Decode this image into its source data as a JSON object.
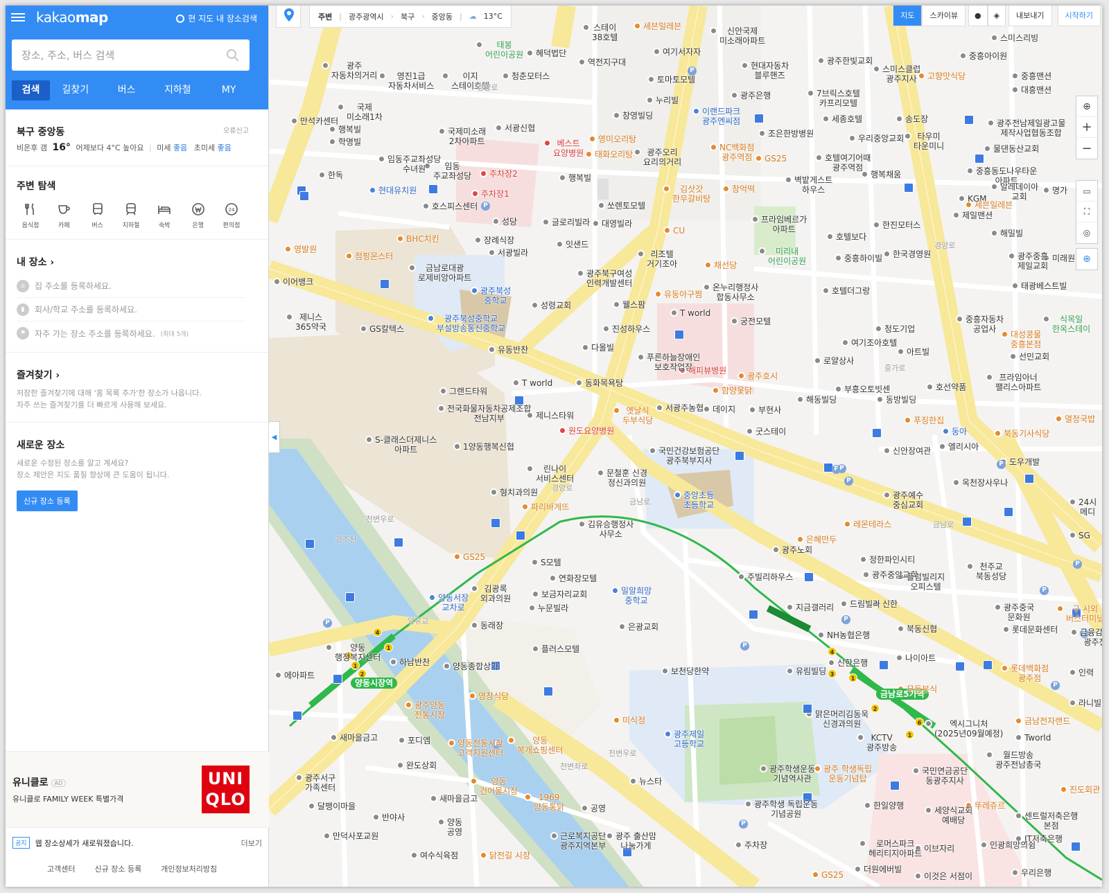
{
  "app": {
    "logo_light": "kakao",
    "logo_bold": "map",
    "here_search": "현 지도 내 장소검색"
  },
  "search": {
    "placeholder": "장소, 주소, 버스 검색"
  },
  "tabs": [
    "검색",
    "길찾기",
    "버스",
    "지하철",
    "MY"
  ],
  "weather": {
    "area": "북구 중앙동",
    "report": "오류신고",
    "desc": "비온후 갬",
    "temp": "16°",
    "compare": "어제보다 4°C 높아요",
    "dust_label": "미세",
    "dust_value": "좋음",
    "fine_label": "초미세",
    "fine_value": "좋음"
  },
  "explore": {
    "title": "주변 탐색",
    "items": [
      "음식점",
      "카페",
      "버스",
      "지하철",
      "숙박",
      "은행",
      "편의점"
    ]
  },
  "myplace": {
    "title": "내 장소",
    "home": "집 주소를 등록하세요.",
    "work": "회사/학교 주소를 등록하세요.",
    "freq": "자주 가는 장소 주소를 등록하세요.",
    "freq_note": "(최대 5개)"
  },
  "favorites": {
    "title": "즐겨찾기",
    "line1": "저장한 즐겨찾기에 대해 '홈 목록 추가'한 장소가 나옵니다.",
    "line2": "자주 쓰는 즐겨찾기를 더 빠르게 사용해 보세요."
  },
  "newplace": {
    "title": "새로운 장소",
    "line1": "새로운 수정된 장소를 알고 계세요?",
    "line2": "장소 제안은 지도 품질 향상에 큰 도움이 됩니다.",
    "button": "신규 장소 등록"
  },
  "ad": {
    "brand": "유니클로",
    "tag": "AD",
    "desc": "유니클로 FAMILY WEEK 특별가격",
    "logo_line1": "UNI",
    "logo_line2": "QLO"
  },
  "notice": {
    "tag": "공지",
    "text": "웹 장소상세가 새로워졌습니다.",
    "more": "더보기"
  },
  "footer": [
    "고객센터",
    "신규 장소 등록",
    "개인정보처리방침"
  ],
  "topbar": {
    "nearby": "주변",
    "crumbs": [
      "광주광역시",
      "북구",
      "중앙동"
    ],
    "temp": "13°C"
  },
  "map_modes": {
    "map": "지도",
    "sky": "스카이뷰",
    "share": "내보내기",
    "start": "시작하기"
  },
  "labels": [
    [
      "광주\n자동차의거리",
      90,
      80,
      ""
    ],
    [
      "영진1급\n자동차서비스",
      172,
      95,
      ""
    ],
    [
      "이지\n스테이호텔",
      263,
      95,
      ""
    ],
    [
      "청춘모터스",
      350,
      95,
      ""
    ],
    [
      "태봉\n어린이공원",
      312,
      50,
      "g"
    ],
    [
      "혜덕법단",
      385,
      62,
      ""
    ],
    [
      "역전지구대",
      460,
      75,
      ""
    ],
    [
      "여기서자자",
      568,
      60,
      ""
    ],
    [
      "현대자동차\n블루핸즈",
      695,
      80,
      ""
    ],
    [
      "광주한빛교회",
      805,
      73,
      ""
    ],
    [
      "스미스클럽\n광주지사",
      885,
      85,
      ""
    ],
    [
      "고향맛식당",
      950,
      95,
      "o"
    ],
    [
      "중흥아이원",
      1010,
      66,
      ""
    ],
    [
      "중흥맨션",
      1085,
      95,
      ""
    ],
    [
      "대흥맨션",
      1085,
      115,
      ""
    ],
    [
      "세븐일레븐",
      540,
      23,
      "o"
    ],
    [
      "신안국제\n미소래아파트",
      650,
      30,
      ""
    ],
    [
      "스테이\n38호텔",
      466,
      25,
      ""
    ],
    [
      "국제\n미소래1차",
      112,
      140,
      ""
    ],
    [
      "만석카센터",
      45,
      160,
      ""
    ],
    [
      "행복빌",
      100,
      172,
      ""
    ],
    [
      "학명빌",
      100,
      190,
      ""
    ],
    [
      "국제미소래\n2차아파트",
      258,
      175,
      ""
    ],
    [
      "서광신협",
      340,
      170,
      ""
    ],
    [
      "토마토모텔",
      560,
      100,
      ""
    ],
    [
      "누리빌",
      558,
      130,
      ""
    ],
    [
      "광주은행",
      680,
      123,
      ""
    ],
    [
      "이랜드파크\n광주엔씨점",
      625,
      146,
      "b"
    ],
    [
      "7브릭스호텔\n카프리모텔",
      790,
      120,
      ""
    ],
    [
      "스미스리빙",
      1055,
      40,
      ""
    ],
    [
      "창영빌딩",
      510,
      152,
      ""
    ],
    [
      "베스트\n요양병원",
      410,
      192,
      "r"
    ],
    [
      "영미오리탕",
      475,
      186,
      "o"
    ],
    [
      "태화오리탕",
      470,
      208,
      "o"
    ],
    [
      "광주오리\n요리의거리",
      540,
      205,
      ""
    ],
    [
      "NC백화점\n광주역점",
      650,
      198,
      "o"
    ],
    [
      "세종호텔",
      812,
      157,
      ""
    ],
    [
      "송도장",
      918,
      157,
      ""
    ],
    [
      "광주전남제일광고물\n제작사업협동조합",
      1050,
      163,
      ""
    ],
    [
      "조은한방병원",
      720,
      178,
      ""
    ],
    [
      "우리중앙교회",
      850,
      185,
      ""
    ],
    [
      "호텔여기어때\n광주역점",
      802,
      213,
      ""
    ],
    [
      "타우미\n타운미니",
      930,
      182,
      ""
    ],
    [
      "물댄동산교회",
      1045,
      200,
      ""
    ],
    [
      "GS25",
      715,
      214,
      "o"
    ],
    [
      "임동주교좌성당\n수녀원",
      171,
      215,
      ""
    ],
    [
      "임동\n주교좌성당",
      237,
      225,
      ""
    ],
    [
      "주차장2",
      318,
      236,
      "r"
    ],
    [
      "행복빌",
      432,
      242,
      ""
    ],
    [
      "김삿갓\n한우갈비탕",
      582,
      258,
      "o"
    ],
    [
      "벽밭게스트\n하우스",
      758,
      245,
      ""
    ],
    [
      "행복채움",
      868,
      237,
      ""
    ],
    [
      "중흥동도나우타운\n아파트",
      1020,
      232,
      ""
    ],
    [
      "알레데이아\n교회",
      1055,
      255,
      ""
    ],
    [
      "명가",
      1130,
      260,
      ""
    ],
    [
      "한독",
      85,
      238,
      ""
    ],
    [
      "현대유치원",
      158,
      260,
      "b"
    ],
    [
      "주차장1",
      306,
      265,
      "r"
    ],
    [
      "창억떡",
      668,
      258,
      "o"
    ],
    [
      "KGM",
      1008,
      272,
      ""
    ],
    [
      "세븐일레븐",
      1018,
      281,
      "o"
    ],
    [
      "호스피스센터",
      235,
      283,
      ""
    ],
    [
      "쏘렌토모텔",
      488,
      282,
      ""
    ],
    [
      "프라임베르가\n아파트",
      710,
      302,
      ""
    ],
    [
      "제일맨션",
      1000,
      296,
      ""
    ],
    [
      "글로리빌라",
      408,
      306,
      ""
    ],
    [
      "대영빌라",
      480,
      308,
      ""
    ],
    [
      "성당",
      336,
      305,
      ""
    ],
    [
      "CU",
      583,
      318,
      "o"
    ],
    [
      "한진모터스",
      885,
      310,
      ""
    ],
    [
      "해밀빌",
      1055,
      322,
      ""
    ],
    [
      "BHC치킨",
      198,
      330,
      "o"
    ],
    [
      "장례식장",
      310,
      332,
      ""
    ],
    [
      "영발원",
      36,
      345,
      "o"
    ],
    [
      "잇샌드",
      428,
      338,
      ""
    ],
    [
      "리조텔\n거기조아",
      545,
      352,
      ""
    ],
    [
      "미리내\n어린이공원",
      720,
      348,
      "g"
    ],
    [
      "호텔보다",
      818,
      327,
      ""
    ],
    [
      "점핑몬스터",
      124,
      355,
      "o"
    ],
    [
      "금남로대광\n로제비앙아파트",
      215,
      372,
      ""
    ],
    [
      "서광빌라",
      330,
      350,
      ""
    ],
    [
      "광주북구여성\n인력개발센터",
      458,
      380,
      ""
    ],
    [
      "중흥하이빌",
      830,
      358,
      ""
    ],
    [
      "한국경영원",
      900,
      352,
      ""
    ],
    [
      "광주중흥\n제일교회",
      1080,
      355,
      ""
    ],
    [
      "미래원",
      1130,
      358,
      ""
    ],
    [
      "채선당",
      642,
      368,
      "o"
    ],
    [
      "광주북성\n중학교",
      305,
      405,
      "b"
    ],
    [
      "온누리행정사\n합동사무소",
      640,
      400,
      ""
    ],
    [
      "유동아구찜",
      570,
      410,
      "o"
    ],
    [
      "호텔더그랑",
      812,
      405,
      ""
    ],
    [
      "태광베스트빌",
      1085,
      398,
      ""
    ],
    [
      "이어뱅크",
      20,
      392,
      ""
    ],
    [
      "성령교회",
      392,
      426,
      ""
    ],
    [
      "웰스팜",
      510,
      425,
      ""
    ],
    [
      "T world",
      593,
      437,
      ""
    ],
    [
      "궁전모텔",
      680,
      449,
      ""
    ],
    [
      "제니스\n365약국",
      38,
      443,
      ""
    ],
    [
      "광주북성중학교\n부설방송통신중학교",
      242,
      445,
      "b"
    ],
    [
      "중흥자동차\n공업사",
      1005,
      446,
      ""
    ],
    [
      "식목일\n한옥스테이",
      1130,
      446,
      "g"
    ],
    [
      "GS칼텍스",
      145,
      460,
      ""
    ],
    [
      "진성하우스",
      495,
      460,
      ""
    ],
    [
      "청도기업",
      888,
      460,
      ""
    ],
    [
      "대성콩물\n중흥본점",
      1070,
      468,
      "o"
    ],
    [
      "여기조아호텔",
      840,
      480,
      ""
    ],
    [
      "다올빌",
      465,
      487,
      ""
    ],
    [
      "아트빌",
      920,
      493,
      ""
    ],
    [
      "유동반찬",
      330,
      490,
      ""
    ],
    [
      "푸른하늘장애인\n보호작업장",
      545,
      501,
      ""
    ],
    [
      "선민교회",
      1082,
      500,
      ""
    ],
    [
      "로얄상사",
      800,
      506,
      ""
    ],
    [
      "해피뷰병원",
      605,
      520,
      "r"
    ],
    [
      "광주호시",
      690,
      528,
      "o"
    ],
    [
      "프라임아너\n팰리스아파트",
      1048,
      530,
      ""
    ],
    [
      "T world",
      365,
      538,
      ""
    ],
    [
      "동화목욕탕",
      456,
      538,
      ""
    ],
    [
      "호선약품",
      962,
      544,
      ""
    ],
    [
      "그랜드타워",
      260,
      550,
      ""
    ],
    [
      "함양옻닭",
      653,
      549,
      "o"
    ],
    [
      "부흥오토빗센",
      830,
      547,
      ""
    ],
    [
      "해동빌딩",
      775,
      562,
      ""
    ],
    [
      "동방빌딩",
      890,
      562,
      ""
    ],
    [
      "전국화물자동차공제조합\n전남지부",
      257,
      575,
      ""
    ],
    [
      "옛날식\n두부식당",
      510,
      578,
      "o"
    ],
    [
      "서광주농협",
      572,
      574,
      ""
    ],
    [
      "데이지",
      640,
      576,
      ""
    ],
    [
      "부현사",
      706,
      577,
      ""
    ],
    [
      "제니스타워",
      385,
      585,
      ""
    ],
    [
      "원도요양병원",
      432,
      607,
      "r"
    ],
    [
      "굿스테이",
      702,
      608,
      ""
    ],
    [
      "푸징한집",
      930,
      592,
      "o"
    ],
    [
      "동아",
      985,
      608,
      "b"
    ],
    [
      "열정국밥",
      1148,
      590,
      "o"
    ],
    [
      "북동기사식당",
      1060,
      611,
      "o"
    ],
    [
      "S-클래스더제니스\n아파트",
      153,
      620,
      ""
    ],
    [
      "1양동행복신협",
      280,
      630,
      ""
    ],
    [
      "국민건강보험공단\n광주북부지사",
      562,
      636,
      ""
    ],
    [
      "신안장여관",
      900,
      636,
      ""
    ],
    [
      "엘리시아",
      980,
      630,
      ""
    ],
    [
      "린나이\n서비스센터",
      385,
      662,
      ""
    ],
    [
      "문철훈 신경\n정신과의원",
      487,
      668,
      ""
    ],
    [
      "도우개발",
      1068,
      652,
      ""
    ],
    [
      "옥천장사우나",
      1000,
      682,
      ""
    ],
    [
      "형치과의원",
      333,
      696,
      ""
    ],
    [
      "중앙초등\n초등학교",
      598,
      700,
      "b"
    ],
    [
      "광주예수\n중심교회",
      900,
      700,
      ""
    ],
    [
      "24시\n메디",
      1168,
      710,
      ""
    ],
    [
      "파리바게뜨",
      378,
      717,
      "o"
    ],
    [
      "김유승행정사\n사무소",
      460,
      742,
      ""
    ],
    [
      "레몬테라스",
      843,
      742,
      "o"
    ],
    [
      "SG",
      1168,
      758,
      ""
    ],
    [
      "은혜만두",
      775,
      764,
      "o"
    ],
    [
      "S모텔",
      392,
      797,
      ""
    ],
    [
      "광주노회",
      740,
      779,
      ""
    ],
    [
      "정한파인시티",
      866,
      793,
      ""
    ],
    [
      "천주교\n북동성당",
      1020,
      803,
      ""
    ],
    [
      "GS25",
      280,
      789,
      "o"
    ],
    [
      "주빌리하우스",
      690,
      818,
      ""
    ],
    [
      "광주중앙교회",
      870,
      815,
      ""
    ],
    [
      "플럼빌리지\n오피스텔",
      920,
      818,
      ""
    ],
    [
      "연화장모텔",
      418,
      820,
      ""
    ],
    [
      "밀알희망\n중학교",
      508,
      838,
      "b"
    ],
    [
      "김광록\n외과의원",
      305,
      835,
      ""
    ],
    [
      "보금자리교회",
      393,
      843,
      ""
    ],
    [
      "양동서장\n교차로",
      244,
      848,
      "b"
    ],
    [
      "누문빌라",
      388,
      863,
      ""
    ],
    [
      "지금갤러리",
      760,
      862,
      ""
    ],
    [
      "드림빌라",
      838,
      857,
      ""
    ],
    [
      "신한",
      885,
      857,
      ""
    ],
    [
      "광주중국\n문화원",
      1060,
      862,
      ""
    ],
    [
      "구 시외\n버스터미널",
      1150,
      864,
      "o"
    ],
    [
      "동래장",
      305,
      888,
      ""
    ],
    [
      "은광교회",
      518,
      890,
      ""
    ],
    [
      "북동신협",
      920,
      893,
      ""
    ],
    [
      "롯데문화센터",
      1072,
      894,
      ""
    ],
    [
      "금융감독\n광주전",
      1170,
      898,
      ""
    ],
    [
      "양동\n행정복지센터",
      95,
      920,
      ""
    ],
    [
      "플러스모텔",
      393,
      922,
      ""
    ],
    [
      "NH농협은행",
      805,
      902,
      ""
    ],
    [
      "나이아트",
      918,
      935,
      ""
    ],
    [
      "하남반찬",
      188,
      941,
      ""
    ],
    [
      "양동종합상가",
      265,
      947,
      ""
    ],
    [
      "신한은행",
      820,
      942,
      ""
    ],
    [
      "보천당한약",
      580,
      954,
      ""
    ],
    [
      "유림빌딩",
      760,
      954,
      ""
    ],
    [
      "롯데백화점\n광주점",
      1070,
      950,
      "o"
    ],
    [
      "인력",
      1168,
      956,
      ""
    ],
    [
      "에아파트",
      22,
      960,
      ""
    ],
    [
      "양동시장역",
      118,
      970,
      "stn"
    ],
    [
      "금남로5가역",
      876,
      986,
      "stn"
    ],
    [
      "무등분식",
      920,
      980,
      "o"
    ],
    [
      "광주양동\n전통시장",
      210,
      1003,
      "o"
    ],
    [
      "영창식당",
      302,
      990,
      "o"
    ],
    [
      "맑은머리김동욱\n신경과의원",
      788,
      1016,
      ""
    ],
    [
      "라니빌딩",
      1168,
      1000,
      ""
    ],
    [
      "엑시그니처\n(2025년09월예정)",
      960,
      1030,
      ""
    ],
    [
      "금남전자랜드",
      1090,
      1026,
      "o"
    ],
    [
      "새마을금고",
      102,
      1050,
      ""
    ],
    [
      "포디엠",
      200,
      1054,
      ""
    ],
    [
      "양동전통시장\n고객지원센터",
      272,
      1058,
      "o"
    ],
    [
      "양동\n복개쇼핑센터",
      358,
      1054,
      "o"
    ],
    [
      "미식정",
      510,
      1025,
      "o"
    ],
    [
      "광주제일\n고등학교",
      584,
      1045,
      "b"
    ],
    [
      "KCTV\n광주방송",
      862,
      1050,
      ""
    ],
    [
      "Tworld",
      1090,
      1050,
      ""
    ],
    [
      "월드방송\n광주전남총국",
      1048,
      1075,
      ""
    ],
    [
      "완도상회",
      198,
      1090,
      ""
    ],
    [
      "광주학생운동\n기념역사관",
      722,
      1095,
      ""
    ],
    [
      "광주 학생독립\n운동기념탑",
      800,
      1095,
      "o"
    ],
    [
      "국민연금공단\n동광주지사",
      942,
      1098,
      ""
    ],
    [
      "양동\n건어물시장",
      304,
      1113,
      "o"
    ],
    [
      "광주서구\n가족센터",
      52,
      1108,
      ""
    ],
    [
      "뉴스타",
      534,
      1113,
      ""
    ],
    [
      "진도회관",
      1155,
      1125,
      "o"
    ],
    [
      "새마을금고",
      246,
      1138,
      ""
    ],
    [
      "1969\n양동통닭",
      382,
      1136,
      "o"
    ],
    [
      "광주학생 독립운동\n기념공원",
      700,
      1146,
      ""
    ],
    [
      "달팽이마을",
      70,
      1149,
      ""
    ],
    [
      "한일양행",
      872,
      1148,
      ""
    ],
    [
      "세양식교회\n예배당",
      960,
      1155,
      ""
    ],
    [
      "뚜레쥬르",
      1018,
      1148,
      "o"
    ],
    [
      "센트럴저축은행\n본점",
      1090,
      1163,
      ""
    ],
    [
      "반야사",
      163,
      1165,
      ""
    ],
    [
      "양동\n공영",
      257,
      1172,
      ""
    ],
    [
      "공영",
      464,
      1152,
      ""
    ],
    [
      "근로복지공단\n광주지역본부",
      420,
      1192,
      ""
    ],
    [
      "광주 출산맘\n나눔가게",
      500,
      1192,
      ""
    ],
    [
      "로머스파크\n헤리티지아파트",
      865,
      1203,
      ""
    ],
    [
      "JT저축은행",
      1090,
      1196,
      ""
    ],
    [
      "만덕사포교원",
      92,
      1192,
      ""
    ],
    [
      "이브자리",
      945,
      1210,
      ""
    ],
    [
      "인광희망의쉼",
      1040,
      1205,
      ""
    ],
    [
      "여수식육점",
      218,
      1220,
      ""
    ],
    [
      "닭전길 시장",
      318,
      1220,
      "o"
    ],
    [
      "주차장",
      686,
      1205,
      ""
    ],
    [
      "더원에버빌",
      858,
      1240,
      ""
    ],
    [
      "우리은행",
      1085,
      1245,
      ""
    ],
    [
      "GS25",
      797,
      1248,
      "o"
    ],
    [
      "이것은 서점이",
      945,
      1250,
      ""
    ],
    [
      "경양로",
      300,
      112,
      "road"
    ],
    [
      "경양로",
      960,
      340,
      "road"
    ],
    [
      "금남로",
      520,
      710,
      "road"
    ],
    [
      "금남로",
      958,
      743,
      "road"
    ],
    [
      "천변우로",
      140,
      735,
      "road"
    ],
    [
      "경양로",
      408,
      690,
      "road"
    ],
    [
      "천변좌로",
      420,
      1092,
      "road"
    ],
    [
      "천변우로",
      490,
      1073,
      "road"
    ],
    [
      "양유교",
      200,
      882,
      "road"
    ],
    [
      "광주천",
      96,
      765,
      "road"
    ],
    [
      "중가로",
      888,
      517,
      "road"
    ]
  ]
}
